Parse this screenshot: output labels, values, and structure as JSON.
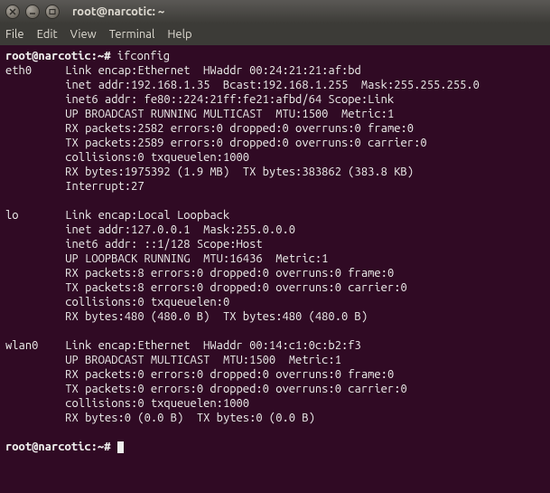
{
  "window": {
    "title": "root@narcotic: ~"
  },
  "menu": {
    "file": "File",
    "edit": "Edit",
    "view": "View",
    "terminal": "Terminal",
    "help": "Help"
  },
  "prompt": {
    "prefix": "root@narcotic",
    "sep": ":",
    "path": "~",
    "char": "#"
  },
  "command": "ifconfig",
  "interfaces": [
    {
      "name": "eth0",
      "lines": [
        "Link encap:Ethernet  HWaddr 00:24:21:21:af:bd  ",
        "inet addr:192.168.1.35  Bcast:192.168.1.255  Mask:255.255.255.0",
        "inet6 addr: fe80::224:21ff:fe21:afbd/64 Scope:Link",
        "UP BROADCAST RUNNING MULTICAST  MTU:1500  Metric:1",
        "RX packets:2582 errors:0 dropped:0 overruns:0 frame:0",
        "TX packets:2589 errors:0 dropped:0 overruns:0 carrier:0",
        "collisions:0 txqueuelen:1000 ",
        "RX bytes:1975392 (1.9 MB)  TX bytes:383862 (383.8 KB)",
        "Interrupt:27 "
      ]
    },
    {
      "name": "lo",
      "lines": [
        "Link encap:Local Loopback  ",
        "inet addr:127.0.0.1  Mask:255.0.0.0",
        "inet6 addr: ::1/128 Scope:Host",
        "UP LOOPBACK RUNNING  MTU:16436  Metric:1",
        "RX packets:8 errors:0 dropped:0 overruns:0 frame:0",
        "TX packets:8 errors:0 dropped:0 overruns:0 carrier:0",
        "collisions:0 txqueuelen:0 ",
        "RX bytes:480 (480.0 B)  TX bytes:480 (480.0 B)"
      ]
    },
    {
      "name": "wlan0",
      "lines": [
        "Link encap:Ethernet  HWaddr 00:14:c1:0c:b2:f3  ",
        "UP BROADCAST MULTICAST  MTU:1500  Metric:1",
        "RX packets:0 errors:0 dropped:0 overruns:0 frame:0",
        "TX packets:0 errors:0 dropped:0 overruns:0 carrier:0",
        "collisions:0 txqueuelen:1000 ",
        "RX bytes:0 (0.0 B)  TX bytes:0 (0.0 B)"
      ]
    }
  ]
}
